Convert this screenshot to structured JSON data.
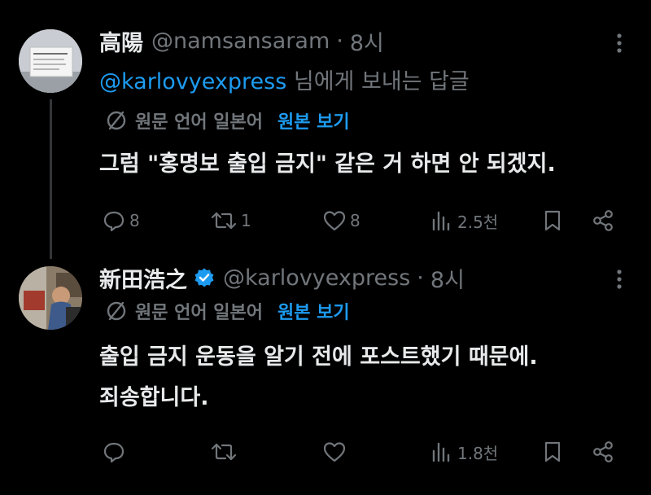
{
  "tweets": [
    {
      "name": "高陽",
      "handle": "@namsansaram",
      "separator": "·",
      "time": "8시",
      "reply_mention": "@karlovyexpress",
      "reply_suffix": " 님에게 보내는 답글",
      "translate_info": "원문 언어 일본어",
      "show_original": "원본 보기",
      "text_lines": [
        "그럼 \"홍명보 출입 금지\" 같은 거 하면 안 되겠지."
      ],
      "reply_count": "8",
      "retweet_count": "1",
      "like_count": "8",
      "view_count": "2.5천",
      "verified": false,
      "avatar_sign_text": "출입 금지"
    },
    {
      "name": "新田浩之",
      "handle": "@karlovyexpress",
      "separator": "·",
      "time": "8시",
      "translate_info": "원문 언어 일본어",
      "show_original": "원본 보기",
      "text_lines": [
        "출입 금지 운동을 알기 전에 포스트했기 때문에.",
        "죄송합니다."
      ],
      "reply_count": "",
      "retweet_count": "",
      "like_count": "",
      "view_count": "1.8천",
      "verified": true
    }
  ],
  "colors": {
    "background": "#000000",
    "primary_text": "#e7e9ea",
    "secondary_text": "#71767b",
    "accent": "#1d9bf0",
    "thread_line": "#333639"
  },
  "icons": {
    "reply": "reply-icon",
    "retweet": "retweet-icon",
    "like": "heart-icon",
    "views": "views-chart-icon",
    "bookmark": "bookmark-icon",
    "share": "share-icon",
    "more": "more-dots-icon",
    "translate": "translate-globe-icon",
    "verified": "verified-badge-icon"
  }
}
